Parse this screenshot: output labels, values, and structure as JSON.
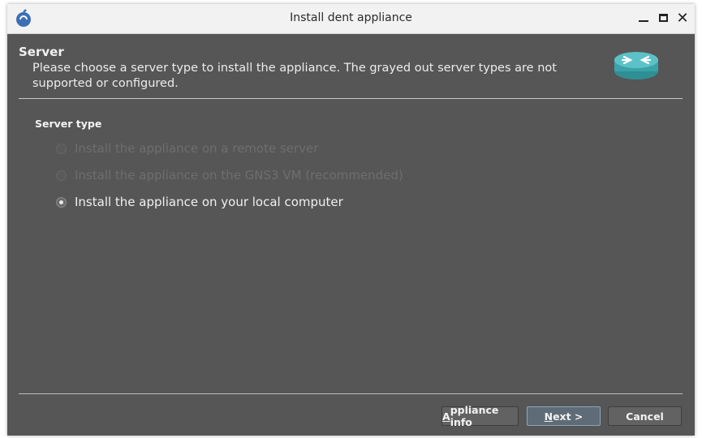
{
  "window": {
    "title": "Install dent appliance",
    "icon": "gns3-logo-icon",
    "controls": {
      "minimize_icon": "minimize-icon",
      "maximize_icon": "maximize-icon",
      "close_label": "✕"
    }
  },
  "header": {
    "title": "Server",
    "subtitle": "Please choose a server type to install the appliance. The grayed out server types are not supported or configured.",
    "logo_icon": "router-icon"
  },
  "server_type": {
    "group_title": "Server type",
    "options": [
      {
        "label": "Install the appliance on a remote server",
        "enabled": false,
        "selected": false
      },
      {
        "label": "Install the appliance on the GNS3 VM (recommended)",
        "enabled": false,
        "selected": false
      },
      {
        "label": "Install the appliance on your local computer",
        "enabled": true,
        "selected": true
      }
    ]
  },
  "buttons": {
    "info_mnemonic": "A",
    "info_rest": "ppliance info",
    "next_mnemonic": "N",
    "next_rest": "ext >",
    "cancel": "Cancel"
  },
  "colors": {
    "body": "#565656",
    "titlebar": "#f2f2f2",
    "accent": "#8aa6c4"
  }
}
